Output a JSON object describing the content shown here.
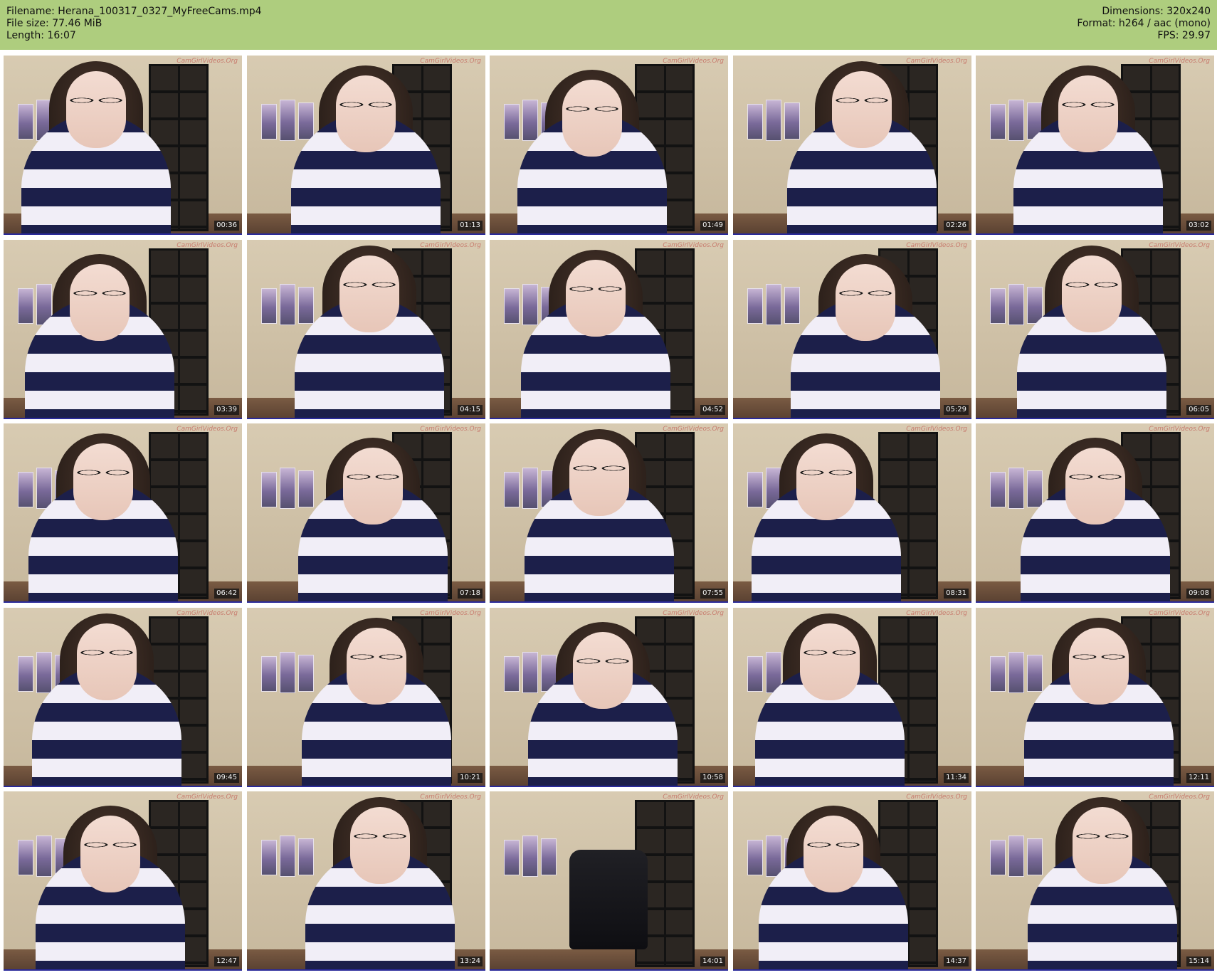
{
  "header": {
    "filename_line": "Filename: Herana_100317_0327_MyFreeCams.mp4",
    "filesize_line": "File size: 77.46 MiB",
    "length_line": "Length: 16:07",
    "dimensions_line": "Dimensions: 320x240",
    "format_line": "Format: h264 / aac (mono)",
    "fps_line": "FPS: 29.97",
    "background_color": "#aecd7e"
  },
  "watermark": "CamGirlVideos.Org",
  "thumbnails": [
    {
      "timestamp": "00:36"
    },
    {
      "timestamp": "01:13"
    },
    {
      "timestamp": "01:49"
    },
    {
      "timestamp": "02:26"
    },
    {
      "timestamp": "03:02"
    },
    {
      "timestamp": "03:39"
    },
    {
      "timestamp": "04:15"
    },
    {
      "timestamp": "04:52"
    },
    {
      "timestamp": "05:29"
    },
    {
      "timestamp": "06:05"
    },
    {
      "timestamp": "06:42"
    },
    {
      "timestamp": "07:18"
    },
    {
      "timestamp": "07:55"
    },
    {
      "timestamp": "08:31"
    },
    {
      "timestamp": "09:08"
    },
    {
      "timestamp": "09:45"
    },
    {
      "timestamp": "10:21"
    },
    {
      "timestamp": "10:58"
    },
    {
      "timestamp": "11:34"
    },
    {
      "timestamp": "12:11"
    },
    {
      "timestamp": "12:47"
    },
    {
      "timestamp": "13:24"
    },
    {
      "timestamp": "14:01"
    },
    {
      "timestamp": "14:37"
    },
    {
      "timestamp": "15:14"
    }
  ]
}
